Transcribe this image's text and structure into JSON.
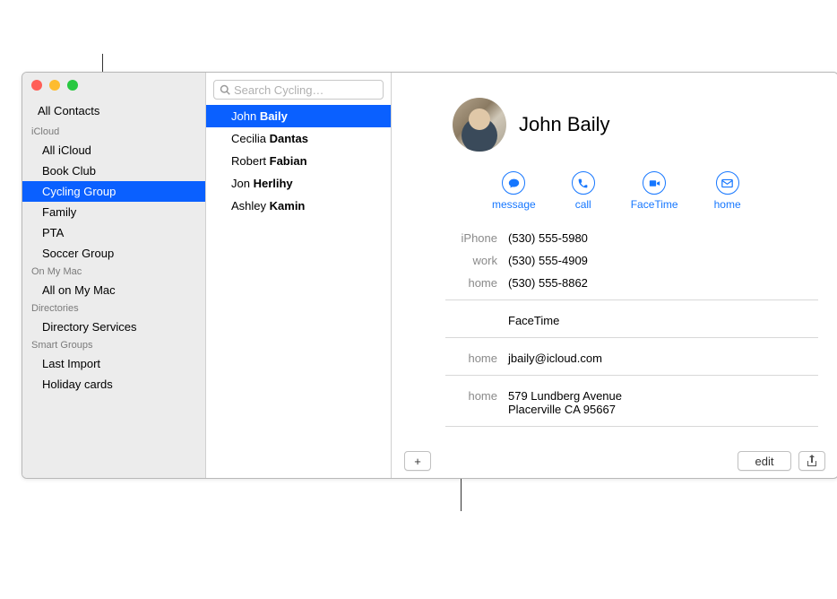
{
  "sidebar": {
    "all_contacts": "All Contacts",
    "sections": [
      {
        "header": "iCloud",
        "items": [
          {
            "label": "All iCloud",
            "selected": false
          },
          {
            "label": "Book Club",
            "selected": false
          },
          {
            "label": "Cycling Group",
            "selected": true
          },
          {
            "label": "Family",
            "selected": false
          },
          {
            "label": "PTA",
            "selected": false
          },
          {
            "label": "Soccer Group",
            "selected": false
          }
        ]
      },
      {
        "header": "On My Mac",
        "items": [
          {
            "label": "All on My Mac",
            "selected": false
          }
        ]
      },
      {
        "header": "Directories",
        "items": [
          {
            "label": "Directory Services",
            "selected": false
          }
        ]
      },
      {
        "header": "Smart Groups",
        "items": [
          {
            "label": "Last Import",
            "selected": false
          },
          {
            "label": "Holiday cards",
            "selected": false
          }
        ]
      }
    ]
  },
  "search": {
    "placeholder": "Search Cycling…"
  },
  "contacts": [
    {
      "first": "John",
      "last": "Baily",
      "selected": true
    },
    {
      "first": "Cecilia",
      "last": "Dantas",
      "selected": false
    },
    {
      "first": "Robert",
      "last": "Fabian",
      "selected": false
    },
    {
      "first": "Jon",
      "last": "Herlihy",
      "selected": false
    },
    {
      "first": "Ashley",
      "last": "Kamin",
      "selected": false
    }
  ],
  "card": {
    "name": "John Baily",
    "actions": {
      "message": "message",
      "call": "call",
      "facetime": "FaceTime",
      "home": "home"
    },
    "phones": [
      {
        "label": "iPhone",
        "value": "(530) 555-5980"
      },
      {
        "label": "work",
        "value": "(530) 555-4909"
      },
      {
        "label": "home",
        "value": "(530) 555-8862"
      }
    ],
    "facetime_label": "FaceTime",
    "emails": [
      {
        "label": "home",
        "value": "jbaily@icloud.com"
      }
    ],
    "addresses": [
      {
        "label": "home",
        "line1": "579 Lundberg Avenue",
        "line2": "Placerville CA 95667"
      }
    ],
    "buttons": {
      "edit": "edit",
      "add": "+"
    }
  },
  "colors": {
    "selection": "#0a60ff",
    "accent": "#1677ff"
  }
}
